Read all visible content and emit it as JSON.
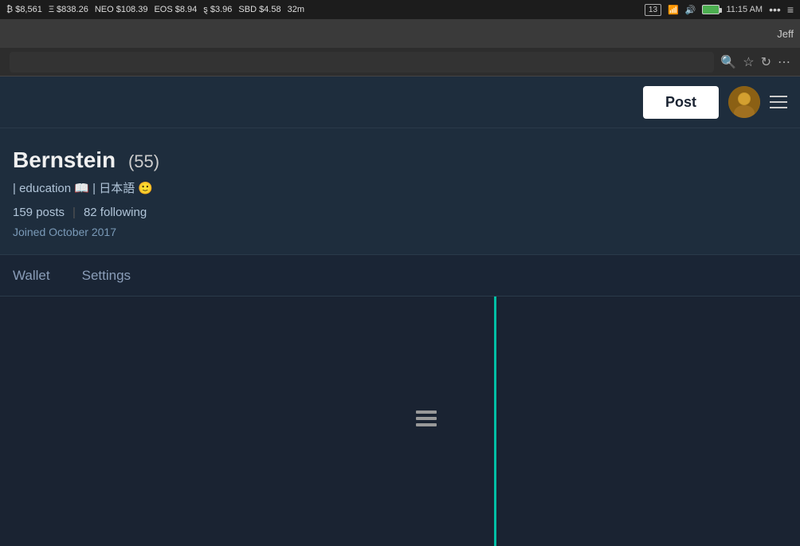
{
  "system_bar": {
    "bitcoin_price": "₿ $8,561",
    "eth_price": "Ξ $838.26",
    "neo_price": "NEO $108.39",
    "eos_price": "EOS $8.94",
    "steem_price": "ȿ $3.96",
    "sbd_price": "SBD $4.58",
    "time_ago": "32m",
    "battery_count": "13",
    "time": "11:15 AM",
    "user": "Jeff"
  },
  "app_header": {
    "post_button_label": "Post"
  },
  "profile": {
    "name": "Bernstein",
    "reputation": "(55)",
    "bio": "| education 📖 | 日本語 🙂",
    "posts_label": "159 posts",
    "following_label": "82 following",
    "joined": "Joined October 2017"
  },
  "tabs": {
    "wallet_label": "Wallet",
    "settings_label": "Settings"
  },
  "icons": {
    "search": "🔍",
    "star": "☆",
    "reload": "↻",
    "more": "⋯",
    "list_view": "≡"
  }
}
